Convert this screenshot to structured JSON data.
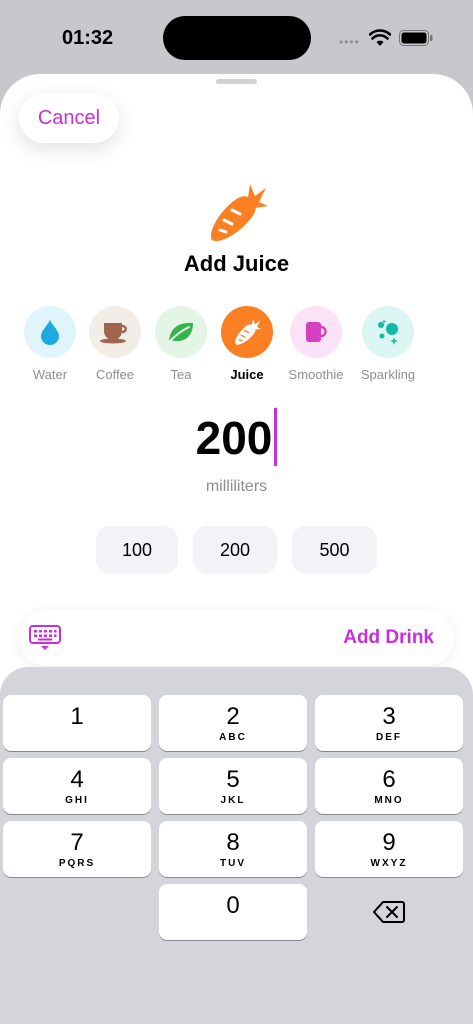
{
  "status": {
    "time": "01:32"
  },
  "sheet": {
    "cancel_label": "Cancel",
    "title": "Add Juice",
    "hero_icon": "carrot-icon",
    "drinks": [
      {
        "label": "Water",
        "icon": "water-drop-icon",
        "bg": "#dff4fb",
        "selected": false
      },
      {
        "label": "Coffee",
        "icon": "coffee-cup-icon",
        "bg": "#f3ede8",
        "selected": false
      },
      {
        "label": "Tea",
        "icon": "leaf-icon",
        "bg": "#e3f5e5",
        "selected": false
      },
      {
        "label": "Juice",
        "icon": "carrot-icon",
        "bg": "#fb7f23",
        "selected": true
      },
      {
        "label": "Smoothie",
        "icon": "mug-icon",
        "bg": "#fae2f7",
        "selected": false
      },
      {
        "label": "Sparkling",
        "icon": "bubbles-icon",
        "bg": "#dcf6f4",
        "selected": false
      }
    ],
    "amount": "200",
    "unit": "milliliters",
    "presets": [
      "100",
      "200",
      "500"
    ],
    "add_drink_label": "Add Drink",
    "accent": "#c62fd9"
  },
  "keypad": {
    "keys": [
      {
        "num": "1",
        "letters": ""
      },
      {
        "num": "2",
        "letters": "ABC"
      },
      {
        "num": "3",
        "letters": "DEF"
      },
      {
        "num": "4",
        "letters": "GHI"
      },
      {
        "num": "5",
        "letters": "JKL"
      },
      {
        "num": "6",
        "letters": "MNO"
      },
      {
        "num": "7",
        "letters": "PQRS"
      },
      {
        "num": "8",
        "letters": "TUV"
      },
      {
        "num": "9",
        "letters": "WXYZ"
      },
      {
        "num": "0",
        "letters": ""
      }
    ]
  }
}
